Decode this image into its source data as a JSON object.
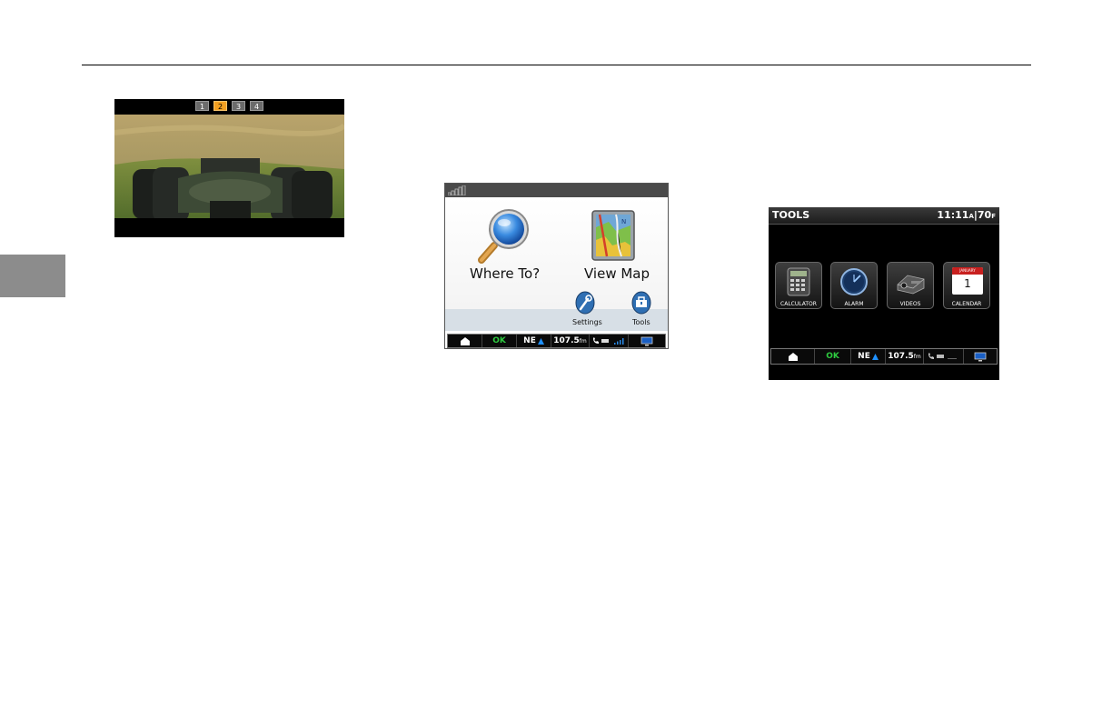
{
  "camera_screen": {
    "tabs": [
      "1",
      "2",
      "3",
      "4"
    ],
    "active_tab": "2"
  },
  "nav_screen": {
    "where_to_label": "Where To?",
    "view_map_label": "View Map",
    "settings_label": "Settings",
    "tools_label": "Tools"
  },
  "status_bar": {
    "ok_label": "OK",
    "direction": "NE",
    "radio_freq": "107.5",
    "radio_unit": "fm"
  },
  "tools_screen": {
    "title": "TOOLS",
    "time": "11:11",
    "time_suffix": "A",
    "temperature": "70",
    "temperature_unit": "F",
    "items": [
      {
        "label": "CALCULATOR",
        "icon": "calculator-icon"
      },
      {
        "label": "ALARM",
        "icon": "alarm-icon"
      },
      {
        "label": "VIDEOS",
        "icon": "videos-icon"
      },
      {
        "label": "CALENDAR",
        "icon": "calendar-icon"
      }
    ],
    "calendar_month": "JANUARY",
    "calendar_day": "1"
  },
  "colors": {
    "active_tab": "#f2a021",
    "ok_green": "#2ecc40",
    "direction_arrow": "#1e90ff",
    "page_tab_gray": "#8c8c8c"
  }
}
